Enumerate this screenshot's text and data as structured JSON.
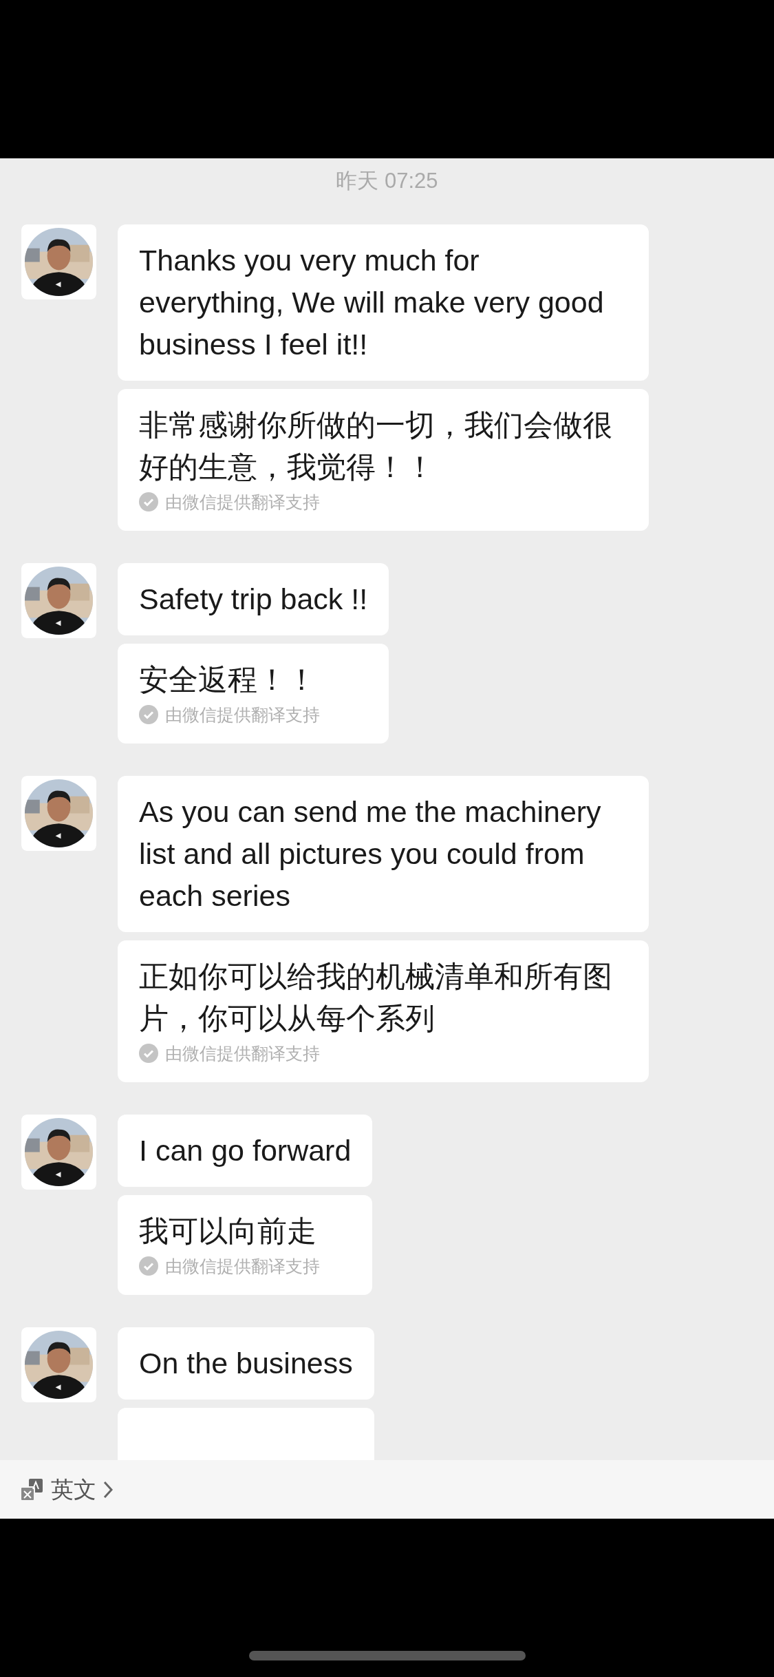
{
  "timestamp": "昨天 07:25",
  "messages": [
    {
      "text": "Thanks you very much for everything, We will make very good  business I feel it!!",
      "translation": "非常感谢你所做的一切，我们会做很好的生意，我觉得！！",
      "note": "由微信提供翻译支持"
    },
    {
      "text": "Safety trip back !!",
      "translation": "安全返程！！",
      "note": "由微信提供翻译支持"
    },
    {
      "text": "As you can send me the machinery list and all pictures you could from each series",
      "translation": "正如你可以给我的机械清单和所有图片，你可以从每个系列",
      "note": "由微信提供翻译支持"
    },
    {
      "text": "I can go forward",
      "translation": "我可以向前走",
      "note": "由微信提供翻译支持"
    },
    {
      "text": "On the business",
      "has_translation": true
    }
  ],
  "language_bar": {
    "label": "英文"
  }
}
